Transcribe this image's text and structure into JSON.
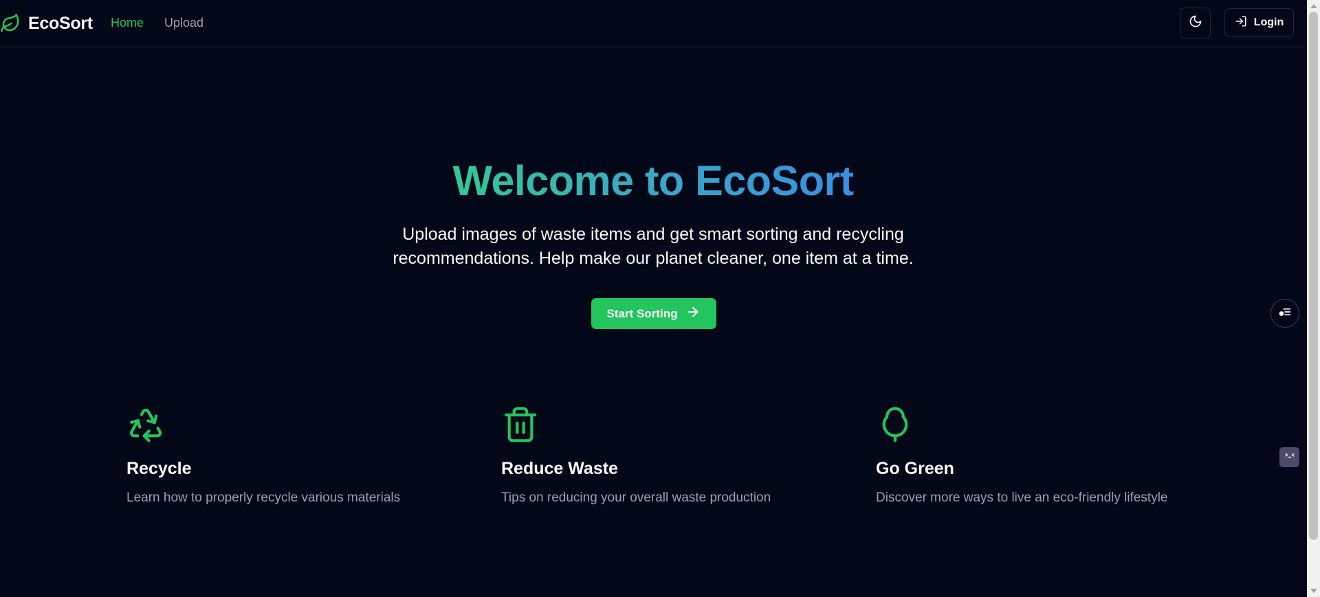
{
  "nav": {
    "brand": "EcoSort",
    "links": [
      {
        "label": "Home",
        "active": true
      },
      {
        "label": "Upload",
        "active": false
      }
    ],
    "theme_toggle_icon": "moon-icon",
    "login_label": "Login",
    "login_icon": "login-icon"
  },
  "hero": {
    "title": "Welcome to EcoSort",
    "subtitle": "Upload images of waste items and get smart sorting and recycling recommendations. Help make our planet cleaner, one item at a time.",
    "cta_label": "Start Sorting",
    "cta_icon": "arrow-right-icon"
  },
  "features": [
    {
      "icon": "recycle-icon",
      "title": "Recycle",
      "description": "Learn how to properly recycle various materials"
    },
    {
      "icon": "trash-icon",
      "title": "Reduce Waste",
      "description": "Tips on reducing your overall waste production"
    },
    {
      "icon": "tree-icon",
      "title": "Go Green",
      "description": "Discover more ways to live an eco-friendly lifestyle"
    }
  ],
  "colors": {
    "background": "#020817",
    "accent": "#22c55e",
    "gradient_start": "#34c795",
    "gradient_end": "#3b8fe0",
    "muted_text": "#94a3b8",
    "border": "#1e293b"
  }
}
